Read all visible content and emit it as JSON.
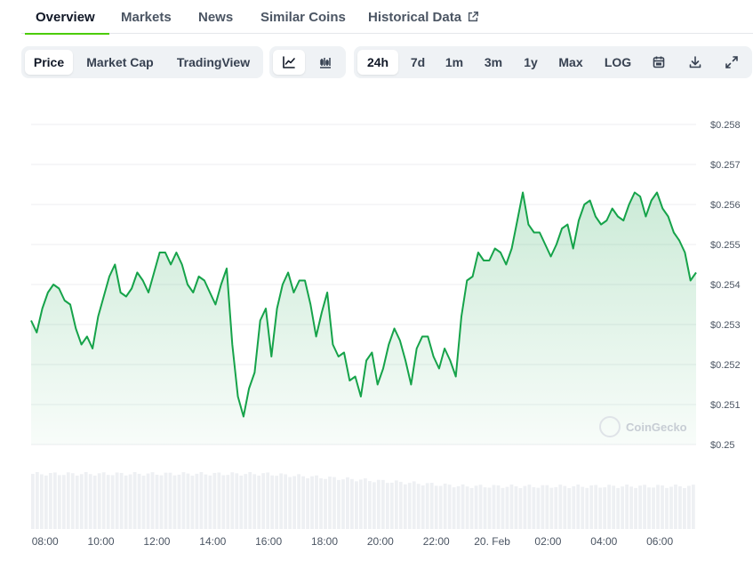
{
  "tabs": [
    {
      "label": "Overview"
    },
    {
      "label": "Markets"
    },
    {
      "label": "News"
    },
    {
      "label": "Similar Coins"
    },
    {
      "label": "Historical Data"
    }
  ],
  "view_toggle": [
    "Price",
    "Market Cap",
    "TradingView"
  ],
  "chart_types": [
    {
      "icon": "line-chart-icon"
    },
    {
      "icon": "candlestick-chart-icon"
    }
  ],
  "ranges": [
    "24h",
    "7d",
    "1m",
    "3m",
    "1y",
    "Max",
    "LOG"
  ],
  "actions": [
    {
      "icon": "calendar-icon"
    },
    {
      "icon": "download-icon"
    },
    {
      "icon": "fullscreen-icon"
    }
  ],
  "watermark": "CoinGecko",
  "colors": {
    "accent": "#4bcc00",
    "line": "#16a34a"
  },
  "chart_data": {
    "type": "area",
    "y_ticks": [
      "$0.258",
      "$0.257",
      "$0.256",
      "$0.255",
      "$0.254",
      "$0.253",
      "$0.252",
      "$0.251",
      "$0.25"
    ],
    "ylim": [
      0.25,
      0.258
    ],
    "x_ticks": [
      "08:00",
      "10:00",
      "12:00",
      "14:00",
      "16:00",
      "18:00",
      "20:00",
      "22:00",
      "20. Feb",
      "02:00",
      "04:00",
      "06:00"
    ],
    "x_hours": [
      0,
      2,
      4,
      6,
      8,
      10,
      12,
      14,
      16,
      18,
      20,
      22
    ],
    "xlim": [
      -0.5,
      23.3
    ],
    "points": [
      [
        -0.5,
        0.2531
      ],
      [
        -0.3,
        0.2528
      ],
      [
        -0.1,
        0.2534
      ],
      [
        0.1,
        0.2538
      ],
      [
        0.3,
        0.254
      ],
      [
        0.5,
        0.2539
      ],
      [
        0.7,
        0.2536
      ],
      [
        0.9,
        0.2535
      ],
      [
        1.1,
        0.2529
      ],
      [
        1.3,
        0.2525
      ],
      [
        1.5,
        0.2527
      ],
      [
        1.7,
        0.2524
      ],
      [
        1.9,
        0.2532
      ],
      [
        2.1,
        0.2537
      ],
      [
        2.3,
        0.2542
      ],
      [
        2.5,
        0.2545
      ],
      [
        2.7,
        0.2538
      ],
      [
        2.9,
        0.2537
      ],
      [
        3.1,
        0.2539
      ],
      [
        3.3,
        0.2543
      ],
      [
        3.5,
        0.2541
      ],
      [
        3.7,
        0.2538
      ],
      [
        3.9,
        0.2543
      ],
      [
        4.1,
        0.2548
      ],
      [
        4.3,
        0.2548
      ],
      [
        4.5,
        0.2545
      ],
      [
        4.7,
        0.2548
      ],
      [
        4.9,
        0.2545
      ],
      [
        5.1,
        0.254
      ],
      [
        5.3,
        0.2538
      ],
      [
        5.5,
        0.2542
      ],
      [
        5.7,
        0.2541
      ],
      [
        5.9,
        0.2538
      ],
      [
        6.1,
        0.2535
      ],
      [
        6.3,
        0.254
      ],
      [
        6.5,
        0.2544
      ],
      [
        6.7,
        0.2525
      ],
      [
        6.9,
        0.2512
      ],
      [
        7.1,
        0.2507
      ],
      [
        7.3,
        0.2514
      ],
      [
        7.5,
        0.2518
      ],
      [
        7.7,
        0.2531
      ],
      [
        7.9,
        0.2534
      ],
      [
        8.1,
        0.2522
      ],
      [
        8.3,
        0.2534
      ],
      [
        8.5,
        0.254
      ],
      [
        8.7,
        0.2543
      ],
      [
        8.9,
        0.2538
      ],
      [
        9.1,
        0.2541
      ],
      [
        9.3,
        0.2541
      ],
      [
        9.5,
        0.2535
      ],
      [
        9.7,
        0.2527
      ],
      [
        9.9,
        0.2533
      ],
      [
        10.1,
        0.2538
      ],
      [
        10.3,
        0.2525
      ],
      [
        10.5,
        0.2522
      ],
      [
        10.7,
        0.2523
      ],
      [
        10.9,
        0.2516
      ],
      [
        11.1,
        0.2517
      ],
      [
        11.3,
        0.2512
      ],
      [
        11.5,
        0.2521
      ],
      [
        11.7,
        0.2523
      ],
      [
        11.9,
        0.2515
      ],
      [
        12.1,
        0.2519
      ],
      [
        12.3,
        0.2525
      ],
      [
        12.5,
        0.2529
      ],
      [
        12.7,
        0.2526
      ],
      [
        12.9,
        0.2521
      ],
      [
        13.1,
        0.2515
      ],
      [
        13.3,
        0.2524
      ],
      [
        13.5,
        0.2527
      ],
      [
        13.7,
        0.2527
      ],
      [
        13.9,
        0.2522
      ],
      [
        14.1,
        0.2519
      ],
      [
        14.3,
        0.2524
      ],
      [
        14.5,
        0.2521
      ],
      [
        14.7,
        0.2517
      ],
      [
        14.9,
        0.2532
      ],
      [
        15.1,
        0.2541
      ],
      [
        15.3,
        0.2542
      ],
      [
        15.5,
        0.2548
      ],
      [
        15.7,
        0.2546
      ],
      [
        15.9,
        0.2546
      ],
      [
        16.1,
        0.2549
      ],
      [
        16.3,
        0.2548
      ],
      [
        16.5,
        0.2545
      ],
      [
        16.7,
        0.2549
      ],
      [
        16.9,
        0.2556
      ],
      [
        17.1,
        0.2563
      ],
      [
        17.3,
        0.2555
      ],
      [
        17.5,
        0.2553
      ],
      [
        17.7,
        0.2553
      ],
      [
        17.9,
        0.255
      ],
      [
        18.1,
        0.2547
      ],
      [
        18.3,
        0.255
      ],
      [
        18.5,
        0.2554
      ],
      [
        18.7,
        0.2555
      ],
      [
        18.9,
        0.2549
      ],
      [
        19.1,
        0.2556
      ],
      [
        19.3,
        0.256
      ],
      [
        19.5,
        0.2561
      ],
      [
        19.7,
        0.2557
      ],
      [
        19.9,
        0.2555
      ],
      [
        20.1,
        0.2556
      ],
      [
        20.3,
        0.2559
      ],
      [
        20.5,
        0.2557
      ],
      [
        20.7,
        0.2556
      ],
      [
        20.9,
        0.256
      ],
      [
        21.1,
        0.2563
      ],
      [
        21.3,
        0.2562
      ],
      [
        21.5,
        0.2557
      ],
      [
        21.7,
        0.2561
      ],
      [
        21.9,
        0.2563
      ],
      [
        22.1,
        0.2559
      ],
      [
        22.3,
        0.2557
      ],
      [
        22.5,
        0.2553
      ],
      [
        22.7,
        0.2551
      ],
      [
        22.9,
        0.2548
      ],
      [
        23.1,
        0.2541
      ],
      [
        23.3,
        0.2543
      ]
    ],
    "volume": "relative volume bars along the bottom"
  }
}
